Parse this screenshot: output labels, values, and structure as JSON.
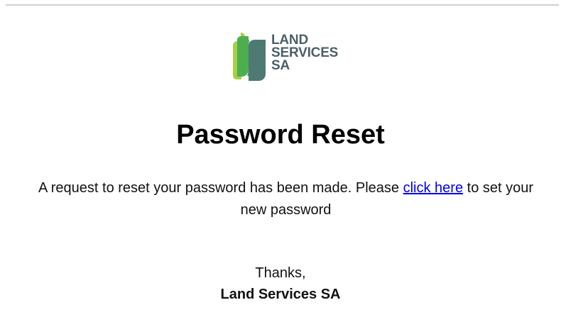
{
  "logo": {
    "icon": "leaf-logo-icon",
    "line1": "LAND",
    "line2": "SERVICES",
    "line3": "SA",
    "colors": {
      "text": "#4b5f6b",
      "light_green": "#a8cf45",
      "green": "#4cae4f",
      "teal": "#3f8a7a",
      "slate": "#4f6f72"
    }
  },
  "email": {
    "title": "Password Reset",
    "message_before": "A request to reset your password has been made. Please ",
    "link_text": "click here",
    "message_after": " to set your new password",
    "thanks": "Thanks,",
    "signature": "Land Services SA"
  },
  "colors": {
    "link": "#0000ee",
    "rule": "#cfcfcf"
  }
}
